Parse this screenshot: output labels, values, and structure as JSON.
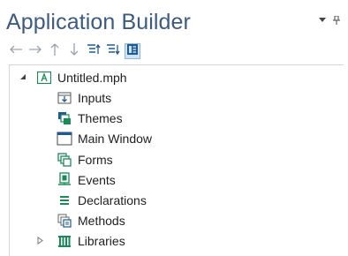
{
  "panel": {
    "title": "Application Builder"
  },
  "toolbar": {
    "buttons": [
      {
        "name": "back",
        "icon": "arrow-left-icon"
      },
      {
        "name": "forward",
        "icon": "arrow-right-icon"
      },
      {
        "name": "up",
        "icon": "arrow-up-icon"
      },
      {
        "name": "down",
        "icon": "arrow-down-icon"
      },
      {
        "name": "collapse-all",
        "icon": "collapse-all-icon"
      },
      {
        "name": "expand-all",
        "icon": "expand-all-icon"
      },
      {
        "name": "show-more",
        "icon": "show-more-icon",
        "active": true
      }
    ]
  },
  "tree": {
    "root": {
      "label": "Untitled.mph",
      "expanded": true,
      "icon": "application-icon"
    },
    "children": [
      {
        "label": "Inputs",
        "icon": "inputs-icon"
      },
      {
        "label": "Themes",
        "icon": "themes-icon"
      },
      {
        "label": "Main Window",
        "icon": "main-window-icon"
      },
      {
        "label": "Forms",
        "icon": "forms-icon"
      },
      {
        "label": "Events",
        "icon": "events-icon"
      },
      {
        "label": "Declarations",
        "icon": "declarations-icon"
      },
      {
        "label": "Methods",
        "icon": "methods-icon"
      },
      {
        "label": "Libraries",
        "icon": "libraries-icon",
        "expandable": true
      }
    ]
  },
  "colors": {
    "title": "#3d5a80",
    "icon_blue": "#1e5a96",
    "icon_green": "#1b8a5a",
    "selection": "#cde3f7"
  }
}
